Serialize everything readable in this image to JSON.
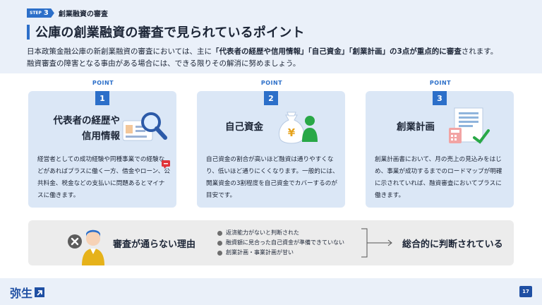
{
  "step": {
    "badge_prefix": "STEP",
    "badge_number": "3",
    "title": "創業融資の審査"
  },
  "heading": "公庫の創業融資の審査で見られているポイント",
  "lead": {
    "line1_a": "日本政策金融公庫の新創業融資の審査においては、主に",
    "line1_b": "「代表者の経歴や信用情報」「自己資金」「創業計画」の3点が重点的に審査",
    "line1_c": "されます。",
    "line2": "融資審査の障害となる事由がある場合には、できる限りその解消に努めましょう。"
  },
  "points": [
    {
      "label": "POINT",
      "number": "1",
      "title_line1": "代表者の経歴や",
      "title_line2": "信用情報",
      "body": "経営者としての成功経験や同種事業での経験などがあればプラスに働く一方、借金やローン、公共料金、税金などの支払いに問題あるとマイナスに働きます。"
    },
    {
      "label": "POINT",
      "number": "2",
      "title_line1": "自己資金",
      "icon_symbol": "¥",
      "body": "自己資金の割合が高いほど融資は通りやすくなり、低いほど通りにくくなります。一般的には、開業資金の3割程度を自己資金でカバーするのが目安です。"
    },
    {
      "label": "POINT",
      "number": "3",
      "title_line1": "創業計画",
      "body": "創業計画書において、月の売上の見込みをはじめ、事業が成功するまでのロードマップが明確に示されていれば、融資審査においてプラスに働きます。"
    }
  ],
  "reason": {
    "title": "審査が通らない理由",
    "items": [
      "返済能力がないと判断された",
      "融資額に見合った自己資金が準備できていない",
      "創業計画・事業計画が甘い"
    ],
    "result": "総合的に判断されている"
  },
  "footer": {
    "logo": "弥生",
    "page": "17"
  },
  "colors": {
    "accent": "#2c6fc9",
    "card_bg": "#dbe7f6",
    "band_bg": "#eaf0f9",
    "logo": "#1f4fa3"
  }
}
